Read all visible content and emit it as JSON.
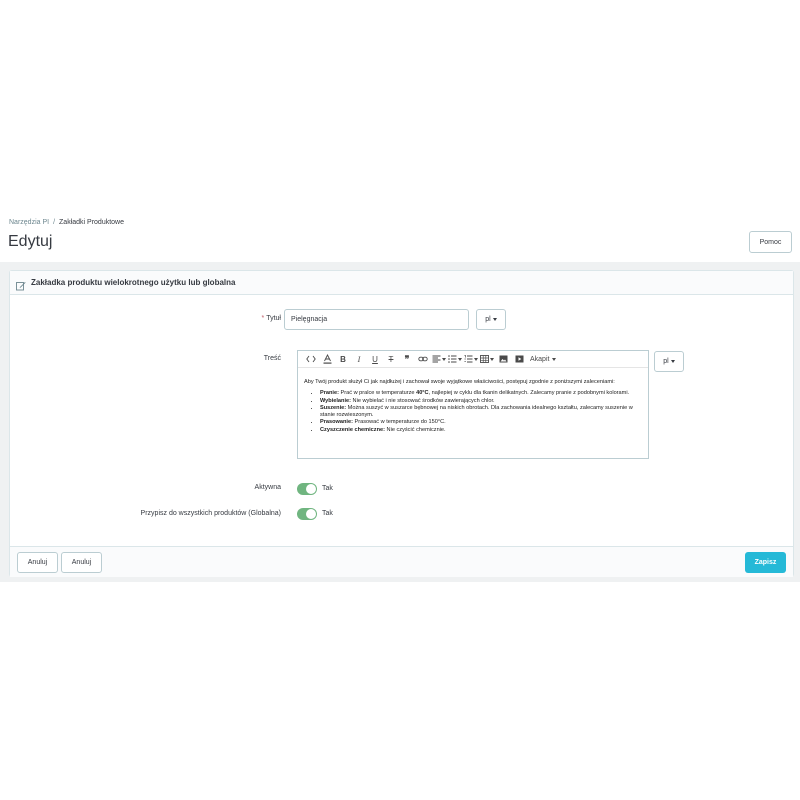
{
  "breadcrumb": {
    "parent": "Narzędzia PI",
    "separator": "/",
    "current": "Zakładki Produktowe"
  },
  "page_title": "Edytuj",
  "help_button": "Pomoc",
  "card": {
    "title": "Zakładka produktu wielokrotnego użytku lub globalna",
    "title_field": {
      "label": "Tytuł",
      "required_mark": "*",
      "value": "Pielęgnacja",
      "lang": "pl"
    },
    "content_field": {
      "label": "Treść",
      "lang": "pl",
      "toolbar": {
        "paragraph_label": "Akapit"
      },
      "intro": "Aby Twój produkt służył Ci jak najdłużej i zachował swoje wyjątkowe właściwości, postępuj zgodnie z poniższymi zaleceniami:",
      "items": [
        {
          "term": "Pranie:",
          "text_before": " Prać w pralce w temperaturze ",
          "bold_value": "40°C",
          "text_after": ", najlepiej w cyklu dla tkanin delikatnych. Zalecamy pranie z podobnymi kolorami."
        },
        {
          "term": "Wybielanie:",
          "text": " Nie wybielać i nie stosować środków zawierających chlor."
        },
        {
          "term": "Suszenie:",
          "text": " Można suszyć w suszarce bębnowej na niskich obrotach. Dla zachowania idealnego kształtu, zalecamy suszenie w stanie rozwieszonym."
        },
        {
          "term": "Prasowanie:",
          "text": " Prasować w temperaturze do 150°C."
        },
        {
          "term": "Czyszczenie chemiczne:",
          "text": " Nie czyścić chemicznie."
        }
      ]
    },
    "active_field": {
      "label": "Aktywna",
      "value": "Tak",
      "on": true
    },
    "global_field": {
      "label": "Przypisz do wszystkich produktów (Globalna)",
      "value": "Tak",
      "on": true
    }
  },
  "footer": {
    "cancel_1": "Anuluj",
    "cancel_2": "Anuluj",
    "save": "Zapisz"
  },
  "colors": {
    "primary": "#25b9d7",
    "switch_on": "#70b580",
    "required": "#c05c67"
  }
}
